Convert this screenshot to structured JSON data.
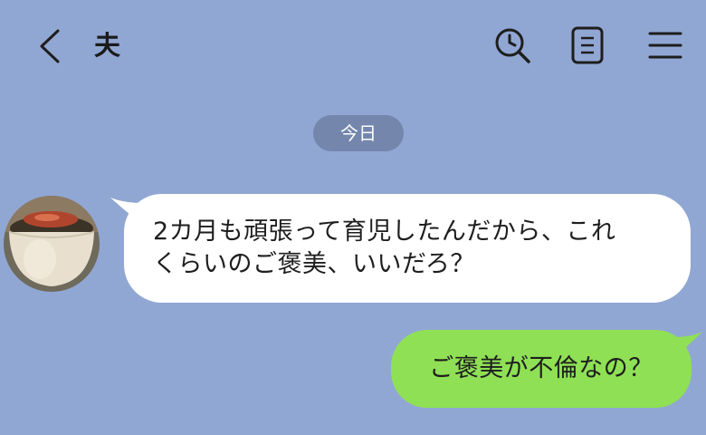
{
  "header": {
    "title": "夫",
    "icons": [
      "back-icon",
      "search-history-icon",
      "notes-icon",
      "menu-icon"
    ]
  },
  "date_separator": "今日",
  "messages": [
    {
      "direction": "incoming",
      "text": "2カ月も頑張って育児したんだから、これ\nくらいのご褒美、いいだろ？"
    },
    {
      "direction": "outgoing",
      "text": "ご褒美が不倫なの？"
    }
  ],
  "colors": {
    "background": "#91a7d3",
    "incoming_bubble": "#ffffff",
    "outgoing_bubble": "#8fe055",
    "date_pill": "#7486ac"
  }
}
